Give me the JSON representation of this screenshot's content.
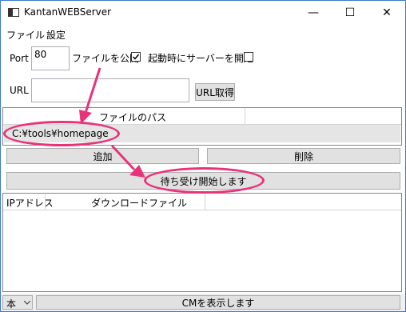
{
  "window": {
    "title": "KantanWEBServer",
    "controls": {
      "minimize": "—",
      "maximize": "☐",
      "close": "✕"
    }
  },
  "menu": {
    "items": [
      "ファイル",
      "設定"
    ]
  },
  "port": {
    "label": "Port",
    "value": "80"
  },
  "publish": {
    "label": "ファイルを公開",
    "checked": true
  },
  "autostart": {
    "label": "起動時にサーバーを開始",
    "checked": false
  },
  "url": {
    "label": "URL",
    "value": "",
    "button": "URL取得"
  },
  "filegrid": {
    "header": "ファイルのパス",
    "rows": [
      "C:¥tools¥homepage"
    ]
  },
  "buttons": {
    "add": "追加",
    "delete": "削除",
    "start": "待ち受け開始します"
  },
  "logs": {
    "col_ip": "IPアドレス",
    "col_file": "ダウンロードファイル"
  },
  "status": {
    "combo": "本",
    "cm": "CMを表示します"
  },
  "colors": {
    "annotation": "#e8337a",
    "accent": "#3b7bc8"
  }
}
